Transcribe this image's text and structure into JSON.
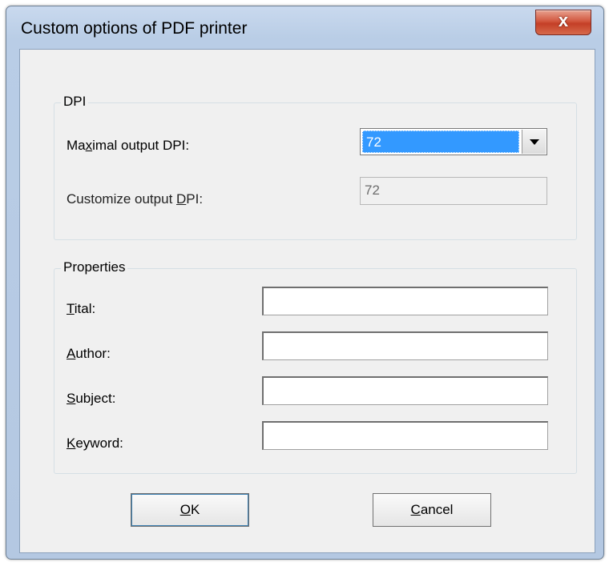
{
  "window": {
    "title": "Custom options of PDF printer",
    "close_glyph": "x"
  },
  "dpi_group": {
    "label": "DPI",
    "max_dpi": {
      "label_pre": "Ma",
      "label_key": "x",
      "label_post": "imal output DPI:",
      "selected": "72"
    },
    "custom_dpi": {
      "label_pre": "Customize output ",
      "label_key": "D",
      "label_post": "PI:",
      "value": "72"
    }
  },
  "properties_group": {
    "label": "Properties",
    "fields": [
      {
        "label_key": "T",
        "label_post": "ital:",
        "value": ""
      },
      {
        "label_key": "A",
        "label_post": "uthor:",
        "value": ""
      },
      {
        "label_key": "S",
        "label_post": "ubject:",
        "value": ""
      },
      {
        "label_key": "K",
        "label_post": "eyword:",
        "value": ""
      }
    ]
  },
  "buttons": {
    "ok_key": "O",
    "ok_post": "K",
    "cancel_key": "C",
    "cancel_post": "ancel"
  }
}
